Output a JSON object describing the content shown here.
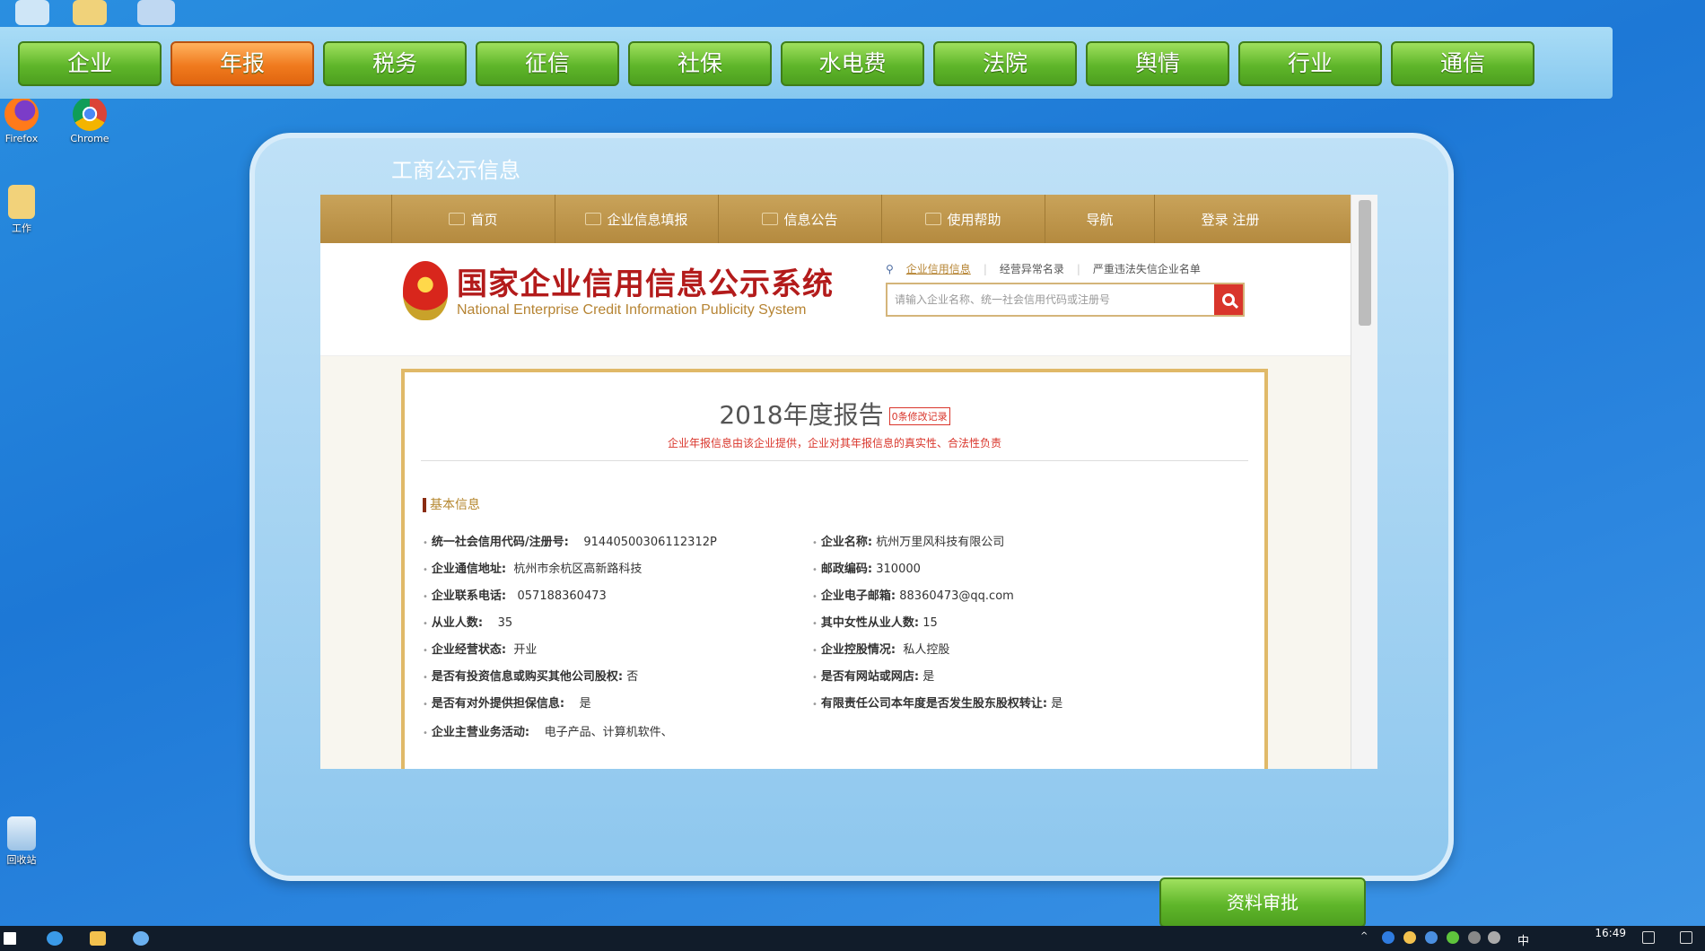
{
  "desktop": {
    "icons": [
      {
        "label": "Firefox"
      },
      {
        "label": "Chrome"
      },
      {
        "label": "工作"
      },
      {
        "label": "回收站"
      }
    ]
  },
  "nav": {
    "tabs": [
      {
        "label": "企业"
      },
      {
        "label": "年报"
      },
      {
        "label": "税务"
      },
      {
        "label": "征信"
      },
      {
        "label": "社保"
      },
      {
        "label": "水电费"
      },
      {
        "label": "法院"
      },
      {
        "label": "舆情"
      },
      {
        "label": "行业"
      },
      {
        "label": "通信"
      }
    ],
    "active_index": 1
  },
  "panel": {
    "title": "工商公示信息"
  },
  "browser": {
    "nav": [
      "首页",
      "企业信息填报",
      "信息公告",
      "使用帮助",
      "导航",
      "登录 注册"
    ],
    "header": {
      "title_cn": "国家企业信用信息公示系统",
      "title_en": "National Enterprise Credit Information Publicity System",
      "search_links": [
        "企业信用信息",
        "经营异常名录",
        "严重违法失信企业名单"
      ],
      "search_placeholder": "请输入企业名称、统一社会信用代码或注册号"
    },
    "report": {
      "title": "2018年度报告",
      "tag": "0条修改记录",
      "subtitle": "企业年报信息由该企业提供，企业对其年报信息的真实性、合法性负责",
      "section": "基本信息",
      "fields_left": [
        {
          "k": "统一社会信用代码/注册号:",
          "v": "91440500306112312P"
        },
        {
          "k": "企业通信地址:",
          "v": "杭州市余杭区高新路科技"
        },
        {
          "k": "企业联系电话:",
          "v": "057188360473"
        },
        {
          "k": "从业人数:",
          "v": "35"
        },
        {
          "k": "企业经营状态:",
          "v": "开业"
        },
        {
          "k": "是否有投资信息或购买其他公司股权:",
          "v": "否"
        },
        {
          "k": "是否有对外提供担保信息:",
          "v": "是"
        },
        {
          "k": "企业主营业务活动:",
          "v": "电子产品、计算机软件、"
        }
      ],
      "fields_right": [
        {
          "k": "企业名称:",
          "v": "杭州万里风科技有限公司"
        },
        {
          "k": "邮政编码:",
          "v": "310000"
        },
        {
          "k": "企业电子邮箱:",
          "v": "88360473@qq.com"
        },
        {
          "k": "其中女性从业人数:",
          "v": "15"
        },
        {
          "k": "企业控股情况:",
          "v": "私人控股"
        },
        {
          "k": "是否有网站或网店:",
          "v": "是"
        },
        {
          "k": "有限责任公司本年度是否发生股东股权转让:",
          "v": "是"
        }
      ]
    }
  },
  "approve_button": "资料审批",
  "taskbar": {
    "time": "16:49",
    "ime": "中"
  }
}
